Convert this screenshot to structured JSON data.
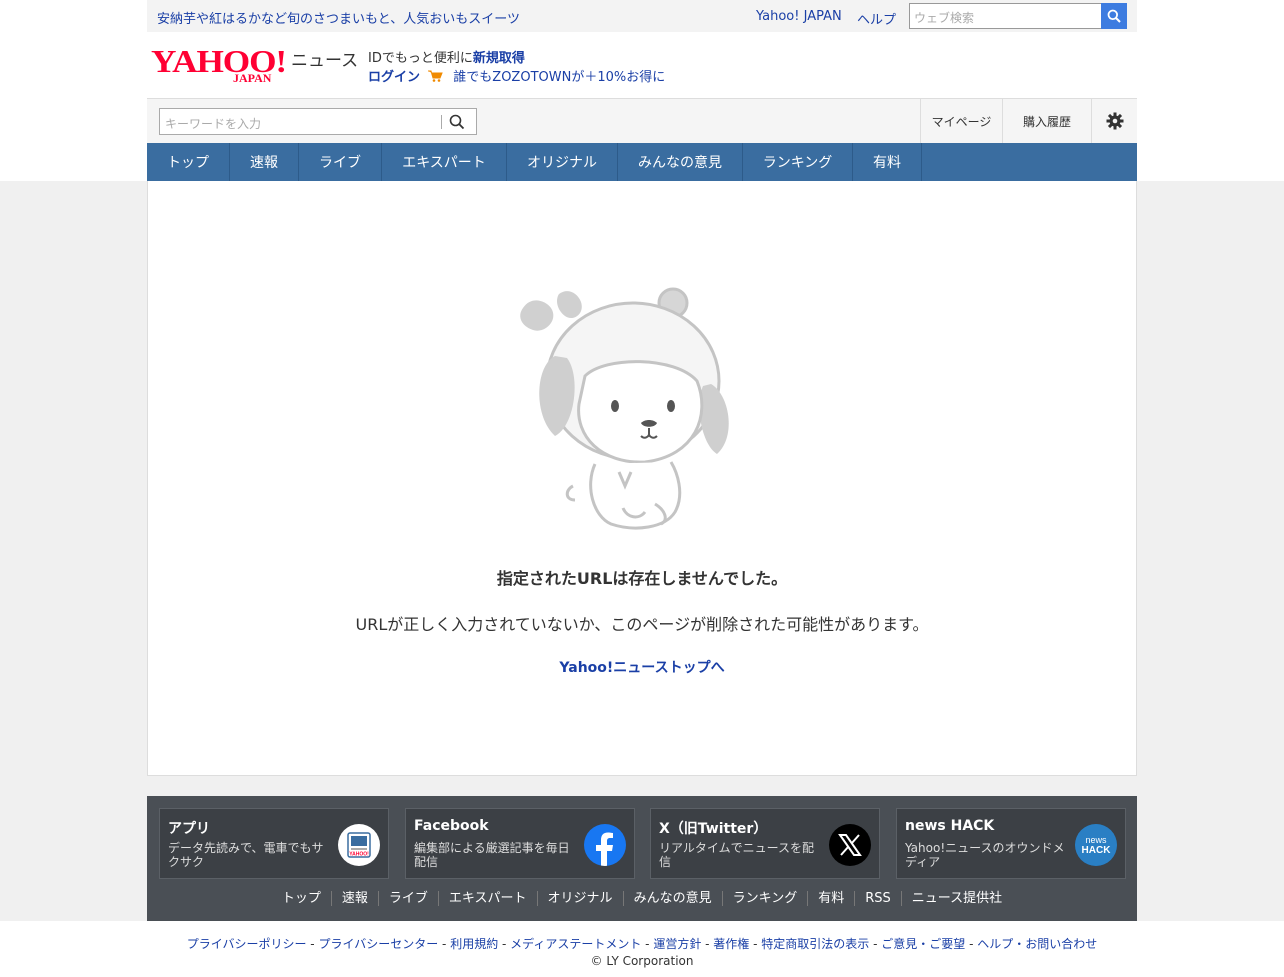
{
  "top": {
    "promo": "安納芋や紅はるかなど旬のさつまいもと、人気おいもスイーツ",
    "yahoo_japan": "Yahoo! JAPAN",
    "help": "ヘルプ",
    "web_search_placeholder": "ウェブ検索"
  },
  "header": {
    "logo_text": "YAHOO!",
    "logo_sub": "JAPAN",
    "logo_news": "ニュース",
    "id_promo_prefix": "IDでもっと便利に",
    "id_promo_link": "新規取得",
    "login": "ログイン",
    "zozo": "誰でもZOZOTOWNが＋10%お得に"
  },
  "searchbar": {
    "placeholder": "キーワードを入力",
    "mypage": "マイページ",
    "history": "購入履歴"
  },
  "nav": [
    "トップ",
    "速報",
    "ライブ",
    "エキスパート",
    "オリジナル",
    "みんなの意見",
    "ランキング",
    "有料"
  ],
  "main": {
    "error_title": "指定されたURLは存在しませんでした。",
    "error_desc": "URLが正しく入力されていないか、このページが削除された可能性があります。",
    "top_link": "Yahoo!ニューストップへ"
  },
  "footer": {
    "cards": [
      {
        "title": "アプリ",
        "desc": "データ先読みで、電車でもサクサク",
        "icon": "yahoo-app-icon"
      },
      {
        "title": "Facebook",
        "desc": "編集部による厳選記事を毎日配信",
        "icon": "facebook-icon"
      },
      {
        "title": "X（旧Twitter）",
        "desc": "リアルタイムでニュースを配信",
        "icon": "x-icon"
      },
      {
        "title": "news HACK",
        "desc": "Yahoo!ニュースのオウンドメディア",
        "icon": "news-hack-icon"
      }
    ],
    "links": [
      "トップ",
      "速報",
      "ライブ",
      "エキスパート",
      "オリジナル",
      "みんなの意見",
      "ランキング",
      "有料",
      "RSS",
      "ニュース提供社"
    ],
    "legal": [
      "プライバシーポリシー",
      "プライバシーセンター",
      "利用規約",
      "メディアステートメント",
      "運営方針",
      "著作権",
      "特定商取引法の表示",
      "ご意見・ご要望",
      "ヘルプ・お問い合わせ"
    ],
    "copyright": "© LY Corporation"
  },
  "colors": {
    "nav_bg": "#3a6da0",
    "link": "#1a3fa6",
    "footer_bg": "#4a4f55",
    "logo_red": "#ff0033"
  }
}
